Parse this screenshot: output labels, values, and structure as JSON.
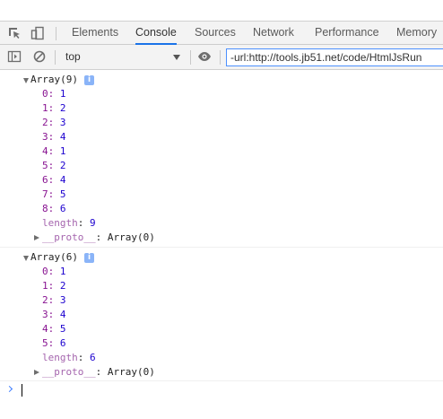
{
  "tabs": [
    {
      "id": "elements",
      "label": "Elements",
      "active": false
    },
    {
      "id": "console",
      "label": "Console",
      "active": true
    },
    {
      "id": "sources",
      "label": "Sources",
      "active": false
    },
    {
      "id": "network",
      "label": "Network",
      "active": false
    },
    {
      "id": "performance",
      "label": "Performance",
      "active": false
    },
    {
      "id": "memory",
      "label": "Memory",
      "active": false
    }
  ],
  "toolbar": {
    "context": "top",
    "filter_value": "-url:http://tools.jb51.net/code/HtmlJsRun"
  },
  "messages": [
    {
      "header": "Array(9)",
      "entries": [
        {
          "k": "0",
          "v": "1"
        },
        {
          "k": "1",
          "v": "2"
        },
        {
          "k": "2",
          "v": "3"
        },
        {
          "k": "3",
          "v": "4"
        },
        {
          "k": "4",
          "v": "1"
        },
        {
          "k": "5",
          "v": "2"
        },
        {
          "k": "6",
          "v": "4"
        },
        {
          "k": "7",
          "v": "5"
        },
        {
          "k": "8",
          "v": "6"
        }
      ],
      "length_key": "length",
      "length_value": "9",
      "proto_key": "__proto__",
      "proto_value": "Array(0)"
    },
    {
      "header": "Array(6)",
      "entries": [
        {
          "k": "0",
          "v": "1"
        },
        {
          "k": "1",
          "v": "2"
        },
        {
          "k": "2",
          "v": "3"
        },
        {
          "k": "3",
          "v": "4"
        },
        {
          "k": "4",
          "v": "5"
        },
        {
          "k": "5",
          "v": "6"
        }
      ],
      "length_key": "length",
      "length_value": "6",
      "proto_key": "__proto__",
      "proto_value": "Array(0)"
    }
  ],
  "colors": {
    "accent": "#1a73e8",
    "key": "#881391",
    "number": "#1c00cf",
    "info": "#8ab4f8"
  },
  "icons": {
    "inspect": "inspect-element-icon",
    "device": "device-toolbar-icon",
    "sidebar": "show-sidebar-icon",
    "clear": "clear-console-icon",
    "eye": "live-expression-eye-icon",
    "info": "info-icon",
    "prompt": "prompt-chevron-icon"
  }
}
